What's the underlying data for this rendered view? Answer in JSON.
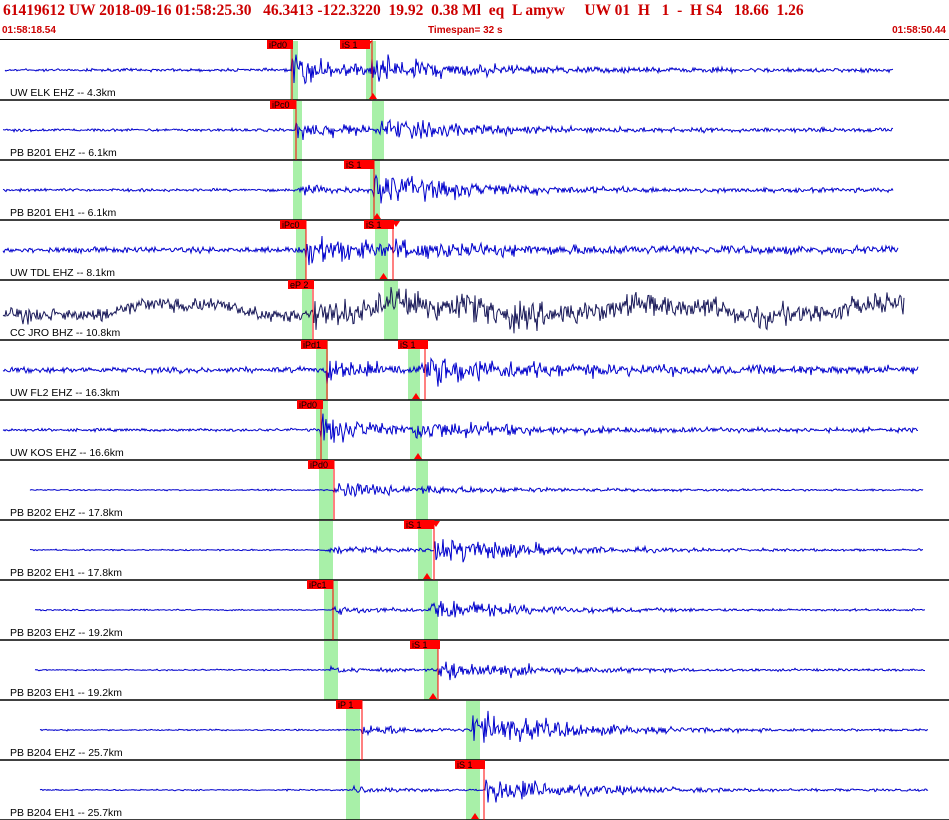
{
  "header": {
    "title": "61419612 UW 2018-09-16 01:58:25.30   46.3413 -122.3220  19.92  0.38 Ml  eq  L amyw     UW 01  H   1  -  H S4   18.66  1.26",
    "start_time": "01:58:18.54",
    "timespan": "Timespan=  32 s",
    "end_time": "01:58:50.44"
  },
  "colors": {
    "trace": "#0000cc",
    "trace_broadband": "#1a1a5a",
    "pick": "#ff0000",
    "pick_label_text": "#000000",
    "window": "#a8f0a8",
    "header_text": "#cc0000",
    "separator": "#000000"
  },
  "channels": [
    {
      "label": "UW ELK EHZ -- 4.3km",
      "p_pick": "iPd0",
      "s_pick": "iS 1"
    },
    {
      "label": "PB B201 EHZ -- 6.1km",
      "p_pick": "iPc0",
      "s_pick": ""
    },
    {
      "label": "PB B201 EH1 -- 6.1km",
      "p_pick": "",
      "s_pick": "iS 1"
    },
    {
      "label": "UW TDL EHZ -- 8.1km",
      "p_pick": "iPc0",
      "s_pick": "iS 1"
    },
    {
      "label": "CC JRO BHZ -- 10.8km",
      "p_pick": "eP 2",
      "s_pick": ""
    },
    {
      "label": "UW FL2 EHZ -- 16.3km",
      "p_pick": "iPd1",
      "s_pick": "iS 1"
    },
    {
      "label": "UW KOS EHZ -- 16.6km",
      "p_pick": "iPd0",
      "s_pick": ""
    },
    {
      "label": "PB B202 EHZ -- 17.8km",
      "p_pick": "iPd0",
      "s_pick": ""
    },
    {
      "label": "PB B202 EH1 -- 17.8km",
      "p_pick": "",
      "s_pick": "iS 1"
    },
    {
      "label": "PB B203 EHZ -- 19.2km",
      "p_pick": "iPc1",
      "s_pick": ""
    },
    {
      "label": "PB B203 EH1 -- 19.2km",
      "p_pick": "",
      "s_pick": "iS 1"
    },
    {
      "label": "PB B204 EHZ -- 25.7km",
      "p_pick": "iP 1",
      "s_pick": ""
    },
    {
      "label": "PB B204 EH1 -- 25.7km",
      "p_pick": "",
      "s_pick": "iS 1"
    }
  ]
}
